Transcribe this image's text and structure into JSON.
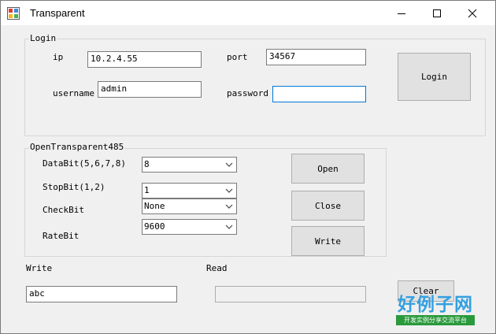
{
  "window": {
    "title": "Transparent"
  },
  "login_group": {
    "title": "Login",
    "ip_label": "ip",
    "ip_value": "10.2.4.55",
    "port_label": "port",
    "port_value": "34567",
    "username_label": "username",
    "username_value": "admin",
    "password_label": "password",
    "password_value": "",
    "login_button": "Login"
  },
  "transparent_group": {
    "title": "OpenTransparent485",
    "databit_label": "DataBit(5,6,7,8)",
    "databit_value": "8",
    "stopbit_label": "StopBit(1,2)",
    "stopbit_value": "1",
    "checkbit_label": "CheckBit",
    "checkbit_value": "None",
    "ratebit_label": "RateBit",
    "ratebit_value": "9600",
    "open_button": "Open",
    "close_button": "Close",
    "write_button": "Write"
  },
  "io": {
    "write_label": "Write",
    "write_value": "abc",
    "read_label": "Read",
    "read_value": "",
    "clear_button": "Clear"
  },
  "watermark": {
    "main": "好例子网",
    "sub": "开发实例分享交流平台"
  }
}
